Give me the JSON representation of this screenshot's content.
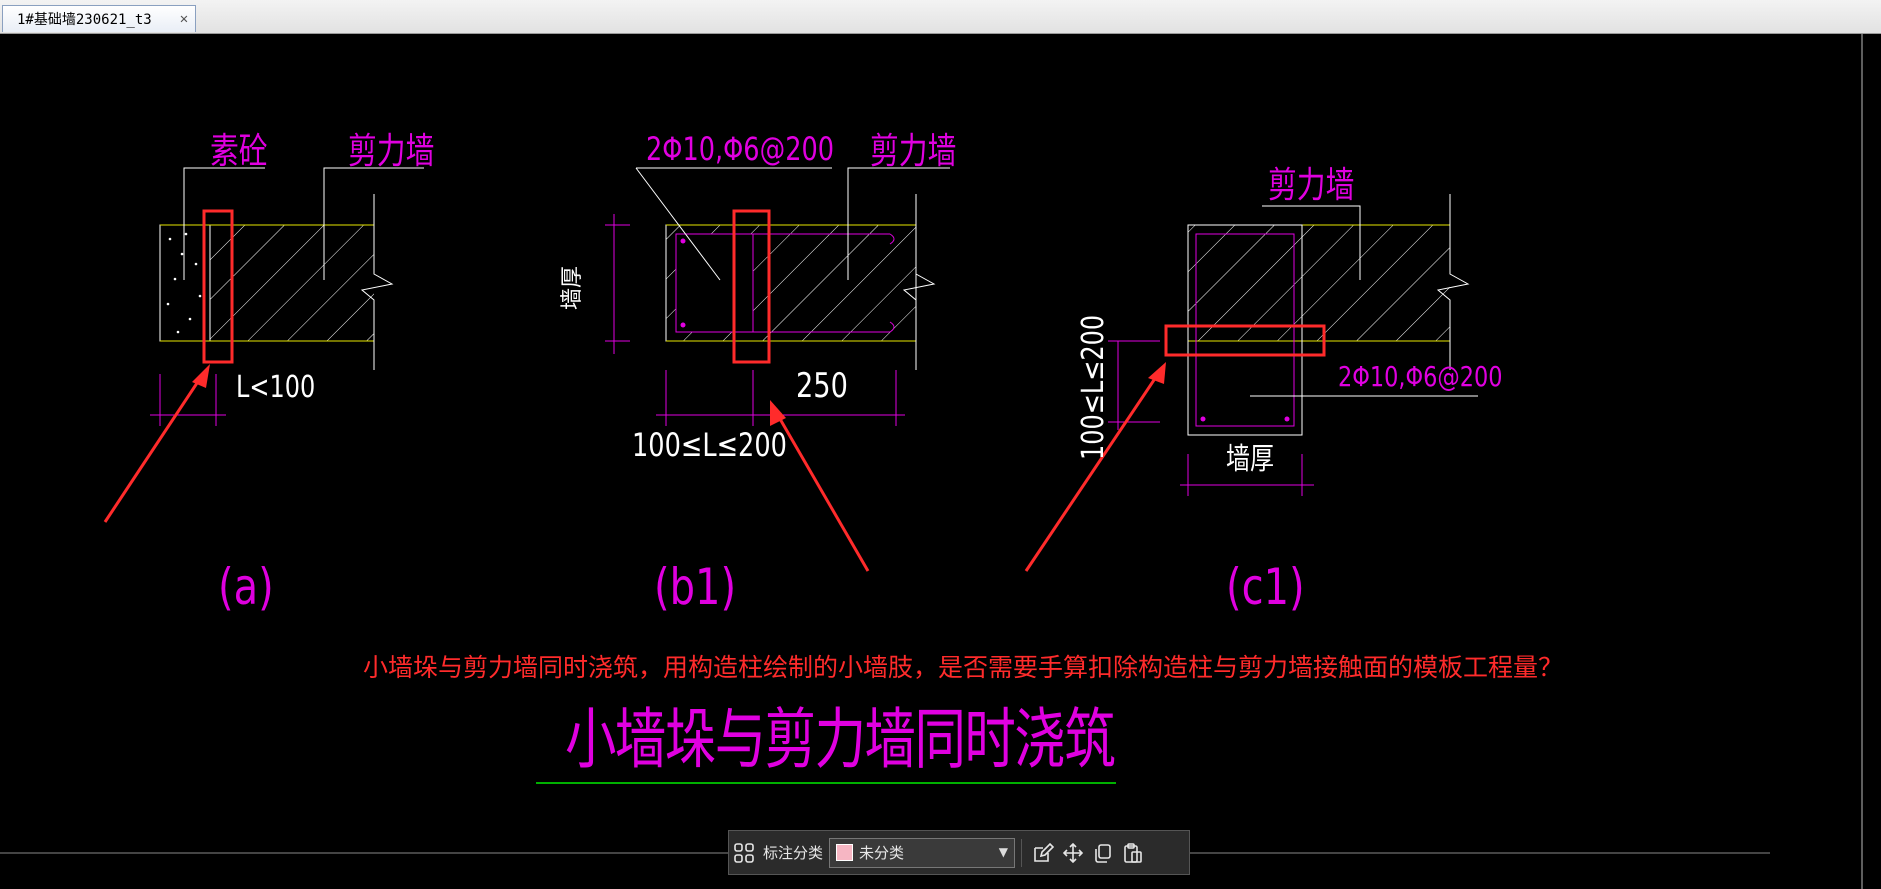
{
  "tab": {
    "title": "1#基础墙230621_t3",
    "close": "✕"
  },
  "drawing": {
    "fig_a": {
      "label_concrete": "素砼",
      "label_wall": "剪力墙",
      "dim": "L<100",
      "caption": "(a)"
    },
    "fig_b1": {
      "label_rebar": "2Φ10,Φ6@200",
      "label_wall": "剪力墙",
      "label_thickness": "墙厚",
      "dim_250": "250",
      "dim_range": "100≤L≤200",
      "caption": "(b1)"
    },
    "fig_c1": {
      "label_wall": "剪力墙",
      "label_rebar": "2Φ10,Φ6@200",
      "label_thickness": "墙厚",
      "dim_range": "100≤L≤200",
      "caption": "(c1)"
    },
    "question": "小墙垛与剪力墙同时浇筑，用构造柱绘制的小墙肢，是否需要手算扣除构造柱与剪力墙接触面的模板工程量？",
    "title": "小墙垛与剪力墙同时浇筑"
  },
  "toolbar": {
    "category_label": "标注分类",
    "category_value": "未分类",
    "category_color": "#f6b6c3",
    "icons": [
      "grid-icon",
      "edit-icon",
      "move-icon",
      "copy-icon",
      "paste-icon"
    ]
  },
  "colors": {
    "magenta": "#e000e0",
    "yellow": "#e6e600",
    "red": "#ff2b2b",
    "green": "#00b000"
  }
}
